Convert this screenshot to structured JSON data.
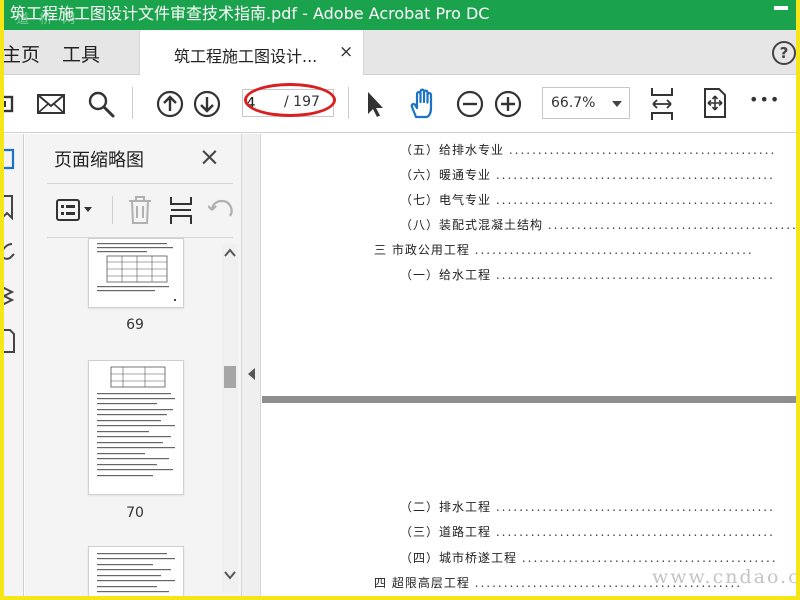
{
  "window": {
    "title": "筑工程施工图设计文件审查技术指南.pdf - Adobe Acrobat Pro DC",
    "watermark_text": "道 桥 网"
  },
  "tabs": {
    "home": "主页",
    "tools": "工具",
    "document": "筑工程施工图设计...",
    "close_glyph": "×",
    "help_glyph": "?"
  },
  "toolbar": {
    "current_page": "4",
    "total_pages": "/ 197",
    "zoom": "66.7%",
    "more_glyph": "•••"
  },
  "panel": {
    "title": "页面缩略图",
    "close_glyph": "×",
    "thumbnails": [
      {
        "page": "69"
      },
      {
        "page": "70"
      }
    ]
  },
  "document": {
    "toc_page1": [
      {
        "label": "（五）给排水专业"
      },
      {
        "label": "（六）暖通专业"
      },
      {
        "label": "（七）电气专业"
      },
      {
        "label": "（八）装配式混凝土结构"
      },
      {
        "label": "三 市政公用工程"
      },
      {
        "label": "（一）给水工程"
      }
    ],
    "toc_page2": [
      {
        "label": "（二）排水工程"
      },
      {
        "label": "（三）道路工程"
      },
      {
        "label": "（四）城市桥遂工程"
      },
      {
        "label": "四 超限高层工程"
      }
    ]
  },
  "site_watermark": "www.cndao.com",
  "colors": {
    "title_bar": "#1aa24c",
    "outer_border": "#f5e61a",
    "annotation_ellipse": "#d92020",
    "hand_tool_active": "#1a73c7"
  },
  "icons": {
    "toolbar": [
      "attach-icon",
      "mail-icon",
      "search-icon",
      "page-up-icon",
      "page-down-icon",
      "select-arrow-icon",
      "hand-icon",
      "zoom-out-icon",
      "zoom-in-icon",
      "fit-page-icon",
      "scroll-mode-icon",
      "more-icon"
    ],
    "panel": [
      "options-icon",
      "delete-icon",
      "insert-page-icon",
      "rotate-icon"
    ]
  }
}
